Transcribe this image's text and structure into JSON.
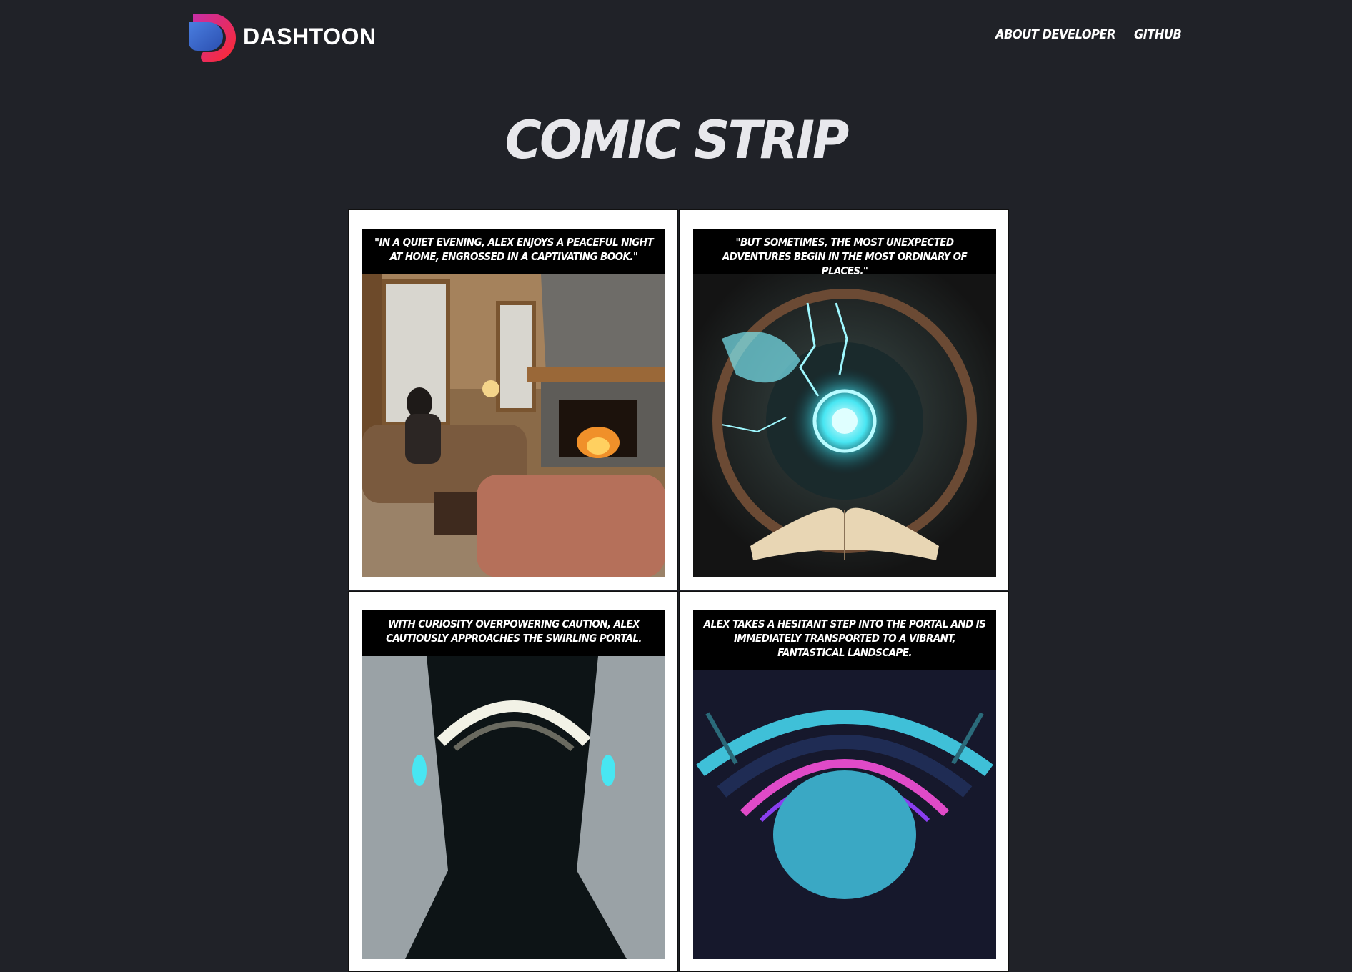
{
  "brand": {
    "name": "DASHTOON",
    "logo_icon": "dashtoon-logo-icon"
  },
  "nav": {
    "links": [
      "ABOUT DEVELOPER",
      "GITHUB"
    ]
  },
  "page": {
    "title": "COMIC STRIP"
  },
  "panels": [
    {
      "caption": "\"IN A QUIET EVENING, ALEX ENJOYS A PEACEFUL NIGHT AT HOME, ENGROSSED IN A CAPTIVATING BOOK.\"",
      "image": "living-room-fireplace-illustration"
    },
    {
      "caption": "\"BUT SOMETIMES, THE MOST UNEXPECTED ADVENTURES BEGIN IN THE MOST ORDINARY OF PLACES.\"",
      "image": "book-glowing-portal-illustration"
    },
    {
      "caption": "WITH CURIOSITY OVERPOWERING CAUTION, ALEX CAUTIOUSLY APPROACHES THE SWIRLING PORTAL.",
      "image": "swirling-portal-tunnel-illustration"
    },
    {
      "caption": "ALEX TAKES A HESITANT STEP INTO THE PORTAL AND IS IMMEDIATELY TRANSPORTED TO A VIBRANT, FANTASTICAL LANDSCAPE.",
      "image": "vibrant-fantasy-landscape-illustration"
    }
  ],
  "colors": {
    "background": "#202228",
    "panel": "#ffffff",
    "caption_bg": "#000000",
    "logo_red": "#e8203a",
    "logo_blue": "#3b7bd8"
  }
}
